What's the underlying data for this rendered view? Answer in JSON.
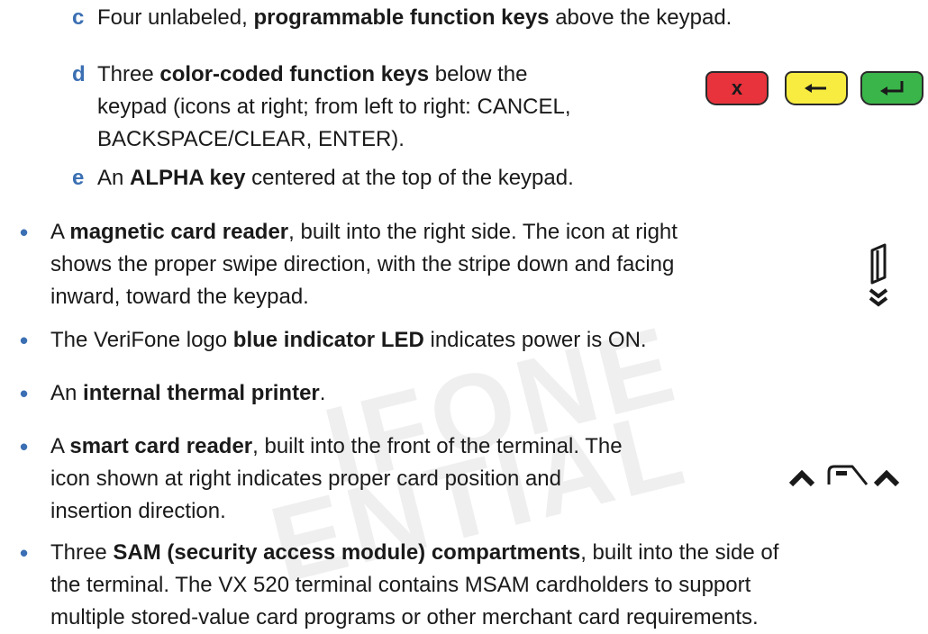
{
  "watermark": {
    "line1": "IFONE",
    "line2": "ENTIAL"
  },
  "items": {
    "c": {
      "marker": "c",
      "t1": "Four unlabeled, ",
      "b1": "programmable function keys",
      "t2": " above the keypad."
    },
    "d": {
      "marker": "d",
      "t1": "Three ",
      "b1": "color-coded function keys",
      "t2": " below the",
      "line2": "keypad (icons at right; from left to right: CANCEL,",
      "line3": "BACKSPACE/CLEAR, ENTER)."
    },
    "e": {
      "marker": "e",
      "t1": "An ",
      "b1": "ALPHA key",
      "t2": " centered at the top of the keypad."
    },
    "magnetic": {
      "marker": "•",
      "t1": "A ",
      "b1": "magnetic card reader",
      "t2": ", built into the right side. The icon at right",
      "line2": "shows the proper swipe direction, with the stripe down and facing",
      "line3": "inward, toward the keypad."
    },
    "led": {
      "marker": "•",
      "t1": "The VeriFone logo ",
      "b1": "blue indicator LED",
      "t2": " indicates power is ON."
    },
    "printer": {
      "marker": "•",
      "t1": "An ",
      "b1": "internal thermal printer",
      "t2": "."
    },
    "smart": {
      "marker": "•",
      "t1": "A ",
      "b1": "smart card reader",
      "t2": ", built into the front of the terminal. The",
      "line2": "icon shown at right indicates proper card position and",
      "line3": "insertion direction."
    },
    "sam": {
      "marker": "•",
      "t1": "Three ",
      "b1": "SAM (security access module) compartments",
      "t2": ", built into the side of",
      "line2": "the terminal. The VX 520 terminal contains MSAM cardholders to support",
      "line3": "multiple stored-value card programs or other merchant card requirements."
    }
  },
  "keys": {
    "cancel": {
      "glyph": "x",
      "color": "#e8323c"
    },
    "backspace": {
      "color": "#f7ec3f"
    },
    "enter": {
      "color": "#3ab54a"
    }
  },
  "colors": {
    "marker": "#3b6fb3",
    "text": "#1a1a1a",
    "watermark": "#efefef"
  }
}
